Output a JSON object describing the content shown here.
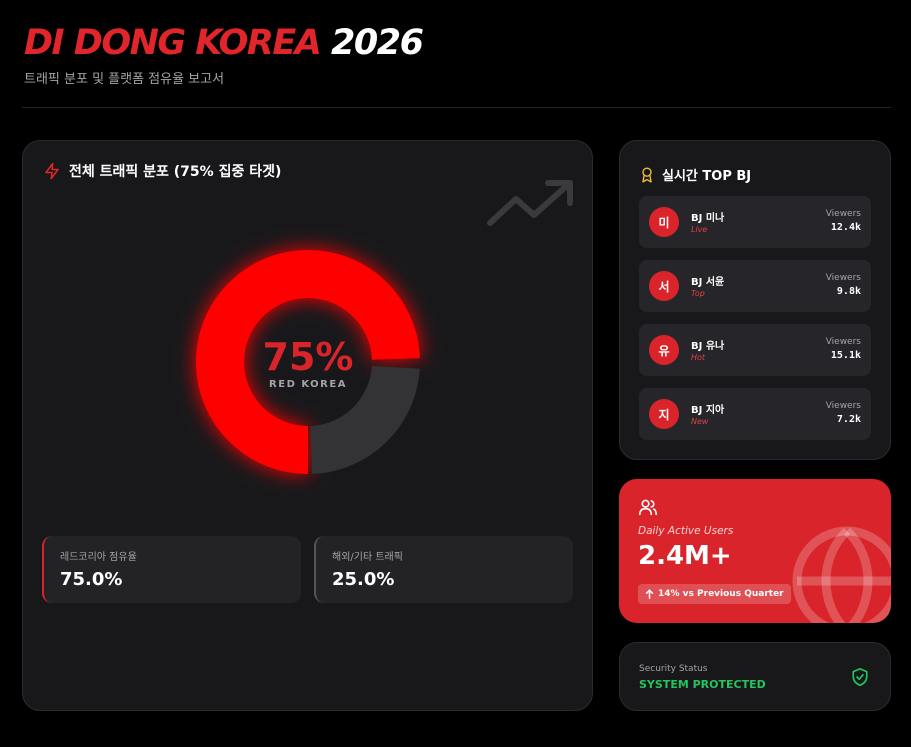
{
  "header": {
    "title_red": "DI DONG KOREA",
    "title_white": "2026",
    "subtitle": "트래픽 분포 및 플랫폼 점유율 보고서"
  },
  "main": {
    "title": "전체 트래픽 분포 (75% 집중 타겟)",
    "icon": "lightning-icon",
    "trend_icon": "trending-up-icon",
    "donut": {
      "percent_text": "75%",
      "label": "RED KOREA",
      "share": 0.75,
      "color_primary": "#ff0000",
      "color_secondary": "#333336"
    },
    "stats": [
      {
        "label": "레드코리아 점유율",
        "value": "75.0%"
      },
      {
        "label": "해외/기타 트래픽",
        "value": "25.0%"
      }
    ]
  },
  "top_bj": {
    "title": "실시간 TOP BJ",
    "icon": "award-icon",
    "items": [
      {
        "initial": "미",
        "name": "BJ 미나",
        "tag": "Live",
        "views_label": "Viewers",
        "views": "12.4k"
      },
      {
        "initial": "서",
        "name": "BJ 서윤",
        "tag": "Top",
        "views_label": "Viewers",
        "views": "9.8k"
      },
      {
        "initial": "유",
        "name": "BJ 유나",
        "tag": "Hot",
        "views_label": "Viewers",
        "views": "15.1k"
      },
      {
        "initial": "지",
        "name": "BJ 지아",
        "tag": "New",
        "views_label": "Viewers",
        "views": "7.2k"
      }
    ]
  },
  "dau": {
    "icon": "users-icon",
    "label": "Daily Active Users",
    "value": "2.4M+",
    "badge": "14% vs Previous Quarter",
    "badge_icon": "arrow-up-icon",
    "bg_icon": "globe-icon"
  },
  "security": {
    "label": "Security Status",
    "value": "SYSTEM PROTECTED",
    "icon": "shield-check-icon"
  },
  "colors": {
    "accent": "#d8242a",
    "background": "#000000",
    "card": "#18181b",
    "success": "#22c55e"
  }
}
